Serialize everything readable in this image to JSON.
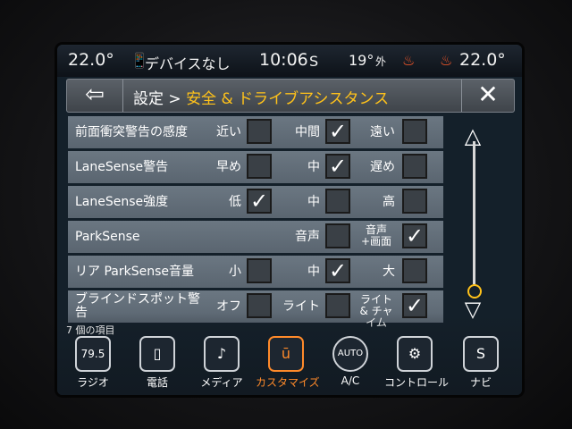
{
  "status": {
    "left_temp": "22.0°",
    "device_label": "デバイスなし",
    "time": "10:06",
    "time_suffix": "S",
    "outside_temp": "19°",
    "outside_label": "外",
    "right_temp": "22.0°"
  },
  "header": {
    "back_icon": "⇦",
    "breadcrumb_prefix": "設定 > ",
    "breadcrumb_current": "安全 & ドライブアシスタンス",
    "close_icon": "✕"
  },
  "rows": [
    {
      "label": "前面衝突警告の感度",
      "options": [
        {
          "text": "近い",
          "checked": false
        },
        {
          "text": "中間",
          "checked": true
        },
        {
          "text": "遠い",
          "checked": false
        }
      ]
    },
    {
      "label": "LaneSense警告",
      "options": [
        {
          "text": "早め",
          "checked": false
        },
        {
          "text": "中",
          "checked": true
        },
        {
          "text": "遅め",
          "checked": false
        }
      ]
    },
    {
      "label": "LaneSense強度",
      "options": [
        {
          "text": "低",
          "checked": true
        },
        {
          "text": "中",
          "checked": false
        },
        {
          "text": "高",
          "checked": false
        }
      ]
    },
    {
      "label": "ParkSense",
      "options": [
        {
          "text": "音声",
          "checked": false
        },
        {
          "text": "音声+画面",
          "checked": true
        }
      ]
    },
    {
      "label": "リア ParkSense音量",
      "options": [
        {
          "text": "小",
          "checked": false
        },
        {
          "text": "中",
          "checked": true
        },
        {
          "text": "大",
          "checked": false
        }
      ]
    },
    {
      "label": "ブラインドスポット警告",
      "options": [
        {
          "text": "オフ",
          "checked": false
        },
        {
          "text": "ライト",
          "checked": false
        },
        {
          "text": "ライト & チャイム",
          "checked": true
        }
      ]
    }
  ],
  "item_count": "7 個の項目",
  "nav": [
    {
      "label": "ラジオ",
      "icon": "79.5"
    },
    {
      "label": "電話",
      "icon": "▯"
    },
    {
      "label": "メディア",
      "icon": "♪"
    },
    {
      "label": "カスタマイズ",
      "icon": "ū",
      "active": true
    },
    {
      "label": "A/C",
      "icon": "AUTO"
    },
    {
      "label": "コントロール",
      "icon": "⚙"
    },
    {
      "label": "ナビ",
      "icon": "S"
    }
  ],
  "check_mark": "✓"
}
